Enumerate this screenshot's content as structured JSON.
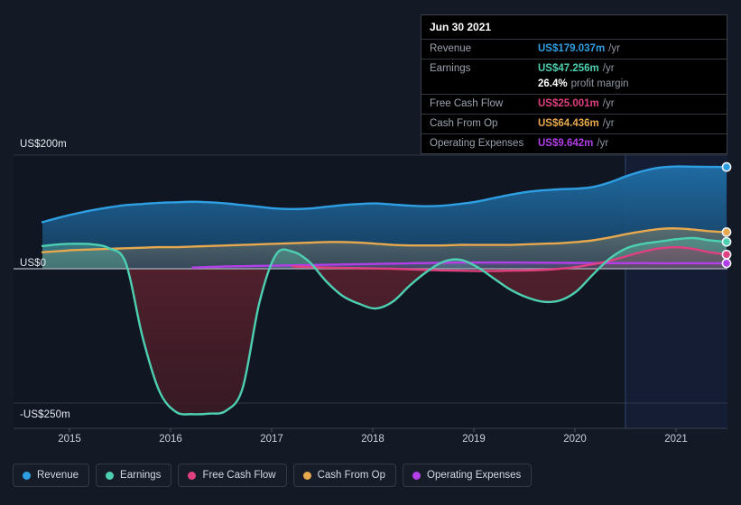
{
  "chart_data": {
    "type": "area",
    "title": "",
    "xlabel": "",
    "ylabel": "",
    "currency": "US$",
    "ylim": [
      -280,
      220
    ],
    "y_ticks": [
      {
        "value": 200,
        "label": "US$200m"
      },
      {
        "value": 0,
        "label": "US$0"
      },
      {
        "value": -250,
        "label": "-US$250m"
      }
    ],
    "x_ticks": [
      "2015",
      "2016",
      "2017",
      "2018",
      "2019",
      "2020",
      "2021"
    ],
    "x_range": [
      "2014-09",
      "2021-12"
    ],
    "grid": true,
    "legend_position": "bottom-left",
    "forecast_divider_label": "2020-09",
    "series": [
      {
        "name": "Revenue",
        "color": "#2f9fe3",
        "values": [
          82,
          90,
          97,
          103,
          108,
          112,
          114,
          116,
          117,
          118,
          117,
          115,
          112,
          109,
          106,
          105,
          106,
          109,
          112,
          114,
          115,
          113,
          111,
          110,
          111,
          114,
          118,
          124,
          130,
          135,
          138,
          140,
          141,
          144,
          152,
          163,
          172,
          178,
          180,
          179.6,
          179.3,
          179.037
        ]
      },
      {
        "name": "Earnings",
        "color": "#4dd0b1",
        "values": [
          40,
          43,
          44,
          43,
          36,
          10,
          -120,
          -215,
          -252,
          -256,
          -255,
          -250,
          -210,
          -60,
          25,
          30,
          12,
          -22,
          -48,
          -62,
          -70,
          -58,
          -30,
          -6,
          12,
          16,
          4,
          -16,
          -36,
          -50,
          -58,
          -56,
          -40,
          -10,
          18,
          36,
          44,
          48,
          52,
          54,
          50,
          47.256
        ]
      },
      {
        "name": "Free Cash Flow",
        "color": "#e0407f",
        "values": [
          null,
          null,
          null,
          null,
          null,
          null,
          null,
          null,
          null,
          null,
          null,
          null,
          null,
          null,
          null,
          4,
          3,
          2,
          1.5,
          1,
          0.5,
          0,
          -1,
          -2,
          -3,
          -3.5,
          -4,
          -4,
          -3.5,
          -3,
          -2,
          0,
          3,
          8,
          14,
          22,
          30,
          36,
          38,
          35,
          29,
          25.001
        ]
      },
      {
        "name": "Cash From Op",
        "color": "#e8a84e",
        "values": [
          29,
          31,
          33,
          34,
          35,
          36,
          37,
          38,
          38,
          39,
          40,
          41,
          42,
          43,
          44,
          45,
          46,
          47,
          47,
          46,
          44,
          42,
          41,
          41,
          41,
          42,
          42,
          42,
          42,
          43,
          44,
          45,
          47,
          50,
          55,
          61,
          66,
          70,
          71,
          69,
          66,
          64.436
        ]
      },
      {
        "name": "Operating Expenses",
        "color": "#b23fe8",
        "values": [
          null,
          null,
          null,
          null,
          null,
          null,
          null,
          null,
          null,
          2,
          3,
          4,
          4.5,
          5,
          5.5,
          6,
          6.5,
          7,
          7.5,
          8,
          8.5,
          9,
          9.5,
          10,
          10.5,
          11,
          11,
          11,
          11,
          10.8,
          10.6,
          10.4,
          10.2,
          10,
          9.9,
          9.8,
          9.8,
          9.7,
          9.7,
          9.7,
          9.65,
          9.642
        ]
      }
    ]
  },
  "tooltip": {
    "date": "Jun 30 2021",
    "rows": [
      {
        "key": "Revenue",
        "value": "US$179.037m",
        "unit": "/yr",
        "color": "#2f9fe3"
      },
      {
        "key": "Earnings",
        "value": "US$47.256m",
        "unit": "/yr",
        "color": "#4dd0b1"
      },
      {
        "key": "",
        "value": "26.4%",
        "unit": "profit margin",
        "color": "#ffffff"
      },
      {
        "key": "Free Cash Flow",
        "value": "US$25.001m",
        "unit": "/yr",
        "color": "#e0407f"
      },
      {
        "key": "Cash From Op",
        "value": "US$64.436m",
        "unit": "/yr",
        "color": "#e8a84e"
      },
      {
        "key": "Operating Expenses",
        "value": "US$9.642m",
        "unit": "/yr",
        "color": "#b23fe8"
      }
    ]
  },
  "legend": {
    "items": [
      {
        "label": "Revenue",
        "color": "#2f9fe3"
      },
      {
        "label": "Earnings",
        "color": "#4dd0b1"
      },
      {
        "label": "Free Cash Flow",
        "color": "#e0407f"
      },
      {
        "label": "Cash From Op",
        "color": "#e8a84e"
      },
      {
        "label": "Operating Expenses",
        "color": "#b23fe8"
      }
    ]
  },
  "theme": {
    "background": "#141a25",
    "plot_background": "#111722",
    "gridline": "#3a4250",
    "zeroline": "#aeb4bf",
    "axis_text": "#c9cfdb"
  }
}
